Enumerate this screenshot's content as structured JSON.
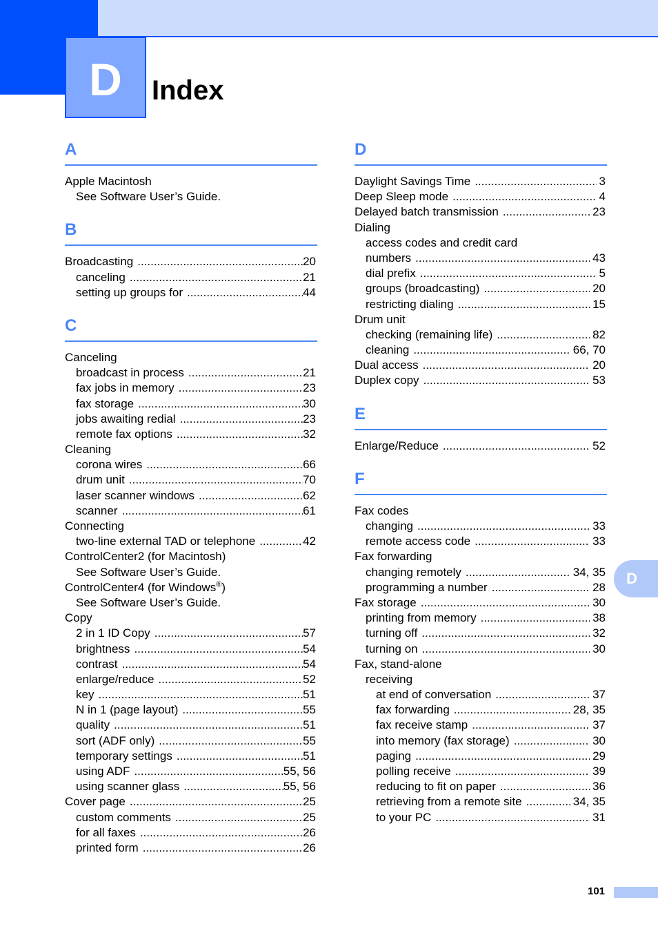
{
  "header": {
    "chapter_letter": "D",
    "title": "Index"
  },
  "colors": {
    "accent_dark": "#0050ff",
    "accent_mid": "#80a8ff",
    "accent_light": "#ccdcfc",
    "section_heading": "#4a86f7",
    "tab": "#b1caf9"
  },
  "side_tab": {
    "letter": "D"
  },
  "footer": {
    "page_number": "101"
  },
  "left_column": [
    {
      "letter": "A",
      "entries": [
        {
          "level": 1,
          "term": "Apple Macintosh",
          "pages": ""
        },
        {
          "level": 2,
          "term": "See Software User’s Guide.",
          "pages": ""
        }
      ]
    },
    {
      "letter": "B",
      "entries": [
        {
          "level": 1,
          "term": "Broadcasting",
          "pages": "20"
        },
        {
          "level": 2,
          "term": "canceling",
          "pages": "21"
        },
        {
          "level": 2,
          "term": "setting up groups for",
          "pages": "44"
        }
      ]
    },
    {
      "letter": "C",
      "entries": [
        {
          "level": 1,
          "term": "Canceling",
          "pages": ""
        },
        {
          "level": 2,
          "term": "broadcast in process",
          "pages": "21"
        },
        {
          "level": 2,
          "term": "fax jobs in memory",
          "pages": "23"
        },
        {
          "level": 2,
          "term": "fax storage",
          "pages": "30"
        },
        {
          "level": 2,
          "term": "jobs awaiting redial",
          "pages": "23"
        },
        {
          "level": 2,
          "term": "remote fax options",
          "pages": "32"
        },
        {
          "level": 1,
          "term": "Cleaning",
          "pages": ""
        },
        {
          "level": 2,
          "term": "corona wires",
          "pages": "66"
        },
        {
          "level": 2,
          "term": "drum unit",
          "pages": "70"
        },
        {
          "level": 2,
          "term": "laser scanner windows",
          "pages": "62"
        },
        {
          "level": 2,
          "term": "scanner",
          "pages": "61"
        },
        {
          "level": 1,
          "term": "Connecting",
          "pages": ""
        },
        {
          "level": 2,
          "term": "two-line external TAD or telephone",
          "pages": "42"
        },
        {
          "level": 1,
          "term": "ControlCenter2 (for Macintosh)",
          "pages": ""
        },
        {
          "level": 2,
          "term": "See Software User’s Guide.",
          "pages": ""
        },
        {
          "level": 1,
          "term": "ControlCenter4 (for Windows",
          "sup": "®",
          "term_after": ")",
          "pages": ""
        },
        {
          "level": 2,
          "term": "See Software User’s Guide.",
          "pages": ""
        },
        {
          "level": 1,
          "term": "Copy",
          "pages": ""
        },
        {
          "level": 2,
          "term": "2 in 1 ID Copy",
          "pages": "57"
        },
        {
          "level": 2,
          "term": "brightness",
          "pages": "54"
        },
        {
          "level": 2,
          "term": "contrast",
          "pages": "54"
        },
        {
          "level": 2,
          "term": "enlarge/reduce",
          "pages": "52"
        },
        {
          "level": 2,
          "term": "key",
          "pages": "51"
        },
        {
          "level": 2,
          "term": "N in 1 (page layout)",
          "pages": "55"
        },
        {
          "level": 2,
          "term": "quality",
          "pages": "51"
        },
        {
          "level": 2,
          "term": "sort (ADF only)",
          "pages": "55"
        },
        {
          "level": 2,
          "term": "temporary settings",
          "pages": "51"
        },
        {
          "level": 2,
          "term": "using ADF",
          "pages": "55, 56"
        },
        {
          "level": 2,
          "term": "using scanner glass",
          "pages": "55, 56"
        },
        {
          "level": 1,
          "term": "Cover page",
          "pages": "25"
        },
        {
          "level": 2,
          "term": "custom comments",
          "pages": "25"
        },
        {
          "level": 2,
          "term": "for all faxes",
          "pages": "26"
        },
        {
          "level": 2,
          "term": "printed form",
          "pages": "26"
        }
      ]
    }
  ],
  "right_column": [
    {
      "letter": "D",
      "entries": [
        {
          "level": 1,
          "term": "Daylight Savings Time",
          "pages": "3"
        },
        {
          "level": 1,
          "term": "Deep Sleep mode",
          "pages": "4"
        },
        {
          "level": 1,
          "term": "Delayed batch transmission",
          "pages": "23"
        },
        {
          "level": 1,
          "term": "Dialing",
          "pages": ""
        },
        {
          "level": 2,
          "term": "access codes and credit card",
          "pages": ""
        },
        {
          "level": 2,
          "term": "numbers",
          "pages": "43"
        },
        {
          "level": 2,
          "term": "dial prefix",
          "pages": "5"
        },
        {
          "level": 2,
          "term": "groups (broadcasting)",
          "pages": "20"
        },
        {
          "level": 2,
          "term": "restricting dialing",
          "pages": "15"
        },
        {
          "level": 1,
          "term": "Drum unit",
          "pages": ""
        },
        {
          "level": 2,
          "term": "checking (remaining life)",
          "pages": "82"
        },
        {
          "level": 2,
          "term": "cleaning",
          "pages": "66, 70"
        },
        {
          "level": 1,
          "term": "Dual access",
          "pages": "20"
        },
        {
          "level": 1,
          "term": "Duplex copy",
          "pages": "53"
        }
      ]
    },
    {
      "letter": "E",
      "entries": [
        {
          "level": 1,
          "term": "Enlarge/Reduce",
          "pages": "52"
        }
      ]
    },
    {
      "letter": "F",
      "entries": [
        {
          "level": 1,
          "term": "Fax codes",
          "pages": ""
        },
        {
          "level": 2,
          "term": "changing",
          "pages": "33"
        },
        {
          "level": 2,
          "term": "remote access code",
          "pages": "33"
        },
        {
          "level": 1,
          "term": "Fax forwarding",
          "pages": ""
        },
        {
          "level": 2,
          "term": "changing remotely",
          "pages": "34, 35"
        },
        {
          "level": 2,
          "term": "programming a number",
          "pages": "28"
        },
        {
          "level": 1,
          "term": "Fax storage",
          "pages": "30"
        },
        {
          "level": 2,
          "term": "printing from memory",
          "pages": "38"
        },
        {
          "level": 2,
          "term": "turning off",
          "pages": "32"
        },
        {
          "level": 2,
          "term": "turning on",
          "pages": "30"
        },
        {
          "level": 1,
          "term": "Fax, stand-alone",
          "pages": ""
        },
        {
          "level": 2,
          "term": "receiving",
          "pages": ""
        },
        {
          "level": 3,
          "term": "at end of conversation",
          "pages": "37"
        },
        {
          "level": 3,
          "term": "fax forwarding",
          "pages": "28, 35"
        },
        {
          "level": 3,
          "term": "fax receive stamp",
          "pages": "37"
        },
        {
          "level": 3,
          "term": "into memory (fax storage)",
          "pages": "30"
        },
        {
          "level": 3,
          "term": "paging",
          "pages": "29"
        },
        {
          "level": 3,
          "term": "polling receive",
          "pages": "39"
        },
        {
          "level": 3,
          "term": "reducing to fit on paper",
          "pages": "36"
        },
        {
          "level": 3,
          "term": "retrieving from a remote site",
          "pages": "34, 35"
        },
        {
          "level": 3,
          "term": "to your PC",
          "pages": "31"
        }
      ]
    }
  ]
}
